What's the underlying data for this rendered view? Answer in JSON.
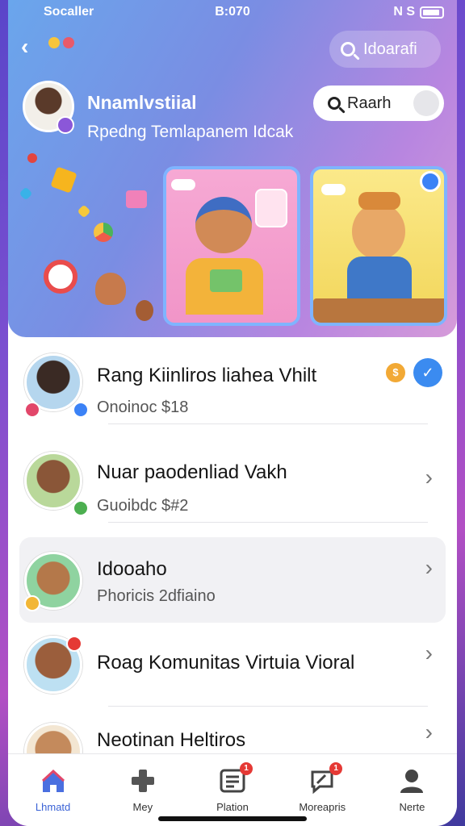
{
  "status_bar": {
    "carrier": "Socaller",
    "time": "B:070",
    "right": "N S"
  },
  "header": {
    "search_label": "Idoarafi"
  },
  "profile": {
    "name": "Nnamlvstiial",
    "subtitle": "Rpedng Temlapanem Idcak",
    "search_pill_label": "Raarh"
  },
  "list": {
    "items": [
      {
        "title": "Rang Kiinliros liahea Vhilt",
        "subtitle": "Onoinoc  $18",
        "badge_count": ""
      },
      {
        "title": "Nuar paodenliad Vakh",
        "subtitle": "Guoibdc  $#2"
      },
      {
        "title": "Idooaho",
        "subtitle": "Phoricis  2dfiaino"
      },
      {
        "title": "Roag Komunitas Virtuia Vioral",
        "subtitle": ""
      },
      {
        "title": "Neotinan Heltiros",
        "subtitle": ""
      }
    ]
  },
  "tabs": [
    {
      "label": "Lhmatd",
      "icon": "home-icon",
      "active": true
    },
    {
      "label": "Mey",
      "icon": "game-icon"
    },
    {
      "label": "Plation",
      "icon": "document-icon",
      "notification": "1"
    },
    {
      "label": "Moreapris",
      "icon": "chat-icon",
      "notification": "1"
    },
    {
      "label": "Nerte",
      "icon": "profile-icon"
    }
  ],
  "colors": {
    "accent": "#3a62d6",
    "header_gradient_start": "#6aa6ec",
    "header_gradient_end": "#d69bd9"
  }
}
